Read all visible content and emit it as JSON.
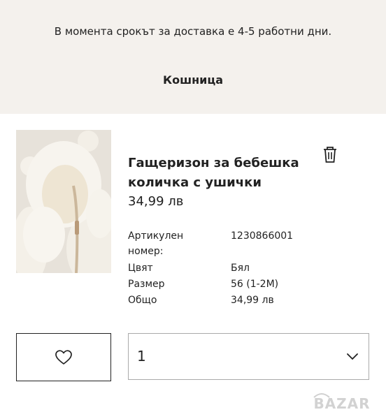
{
  "header": {
    "notice": "В момента срокът за доставка е 4-5 работни дни.",
    "title": "Кошница"
  },
  "product": {
    "name": "Гащеризон за бебешка количка с ушички",
    "price": "34,99 лв",
    "details": [
      {
        "label": "Артикулен номер:",
        "value": "1230866001"
      },
      {
        "label": "Цвят",
        "value": "Бял"
      },
      {
        "label": "Размер",
        "value": "56 (1-2M)"
      },
      {
        "label": "Общо",
        "value": "34,99 лв"
      }
    ]
  },
  "quantity": {
    "selected": "1"
  },
  "icons": {
    "delete": "trash-icon",
    "favorite": "heart-icon",
    "dropdown": "chevron-down-icon"
  },
  "watermark": "BAZAR",
  "colors": {
    "top_band": "#f4f1ed",
    "text": "#222222",
    "border": "#aaaaaa"
  }
}
